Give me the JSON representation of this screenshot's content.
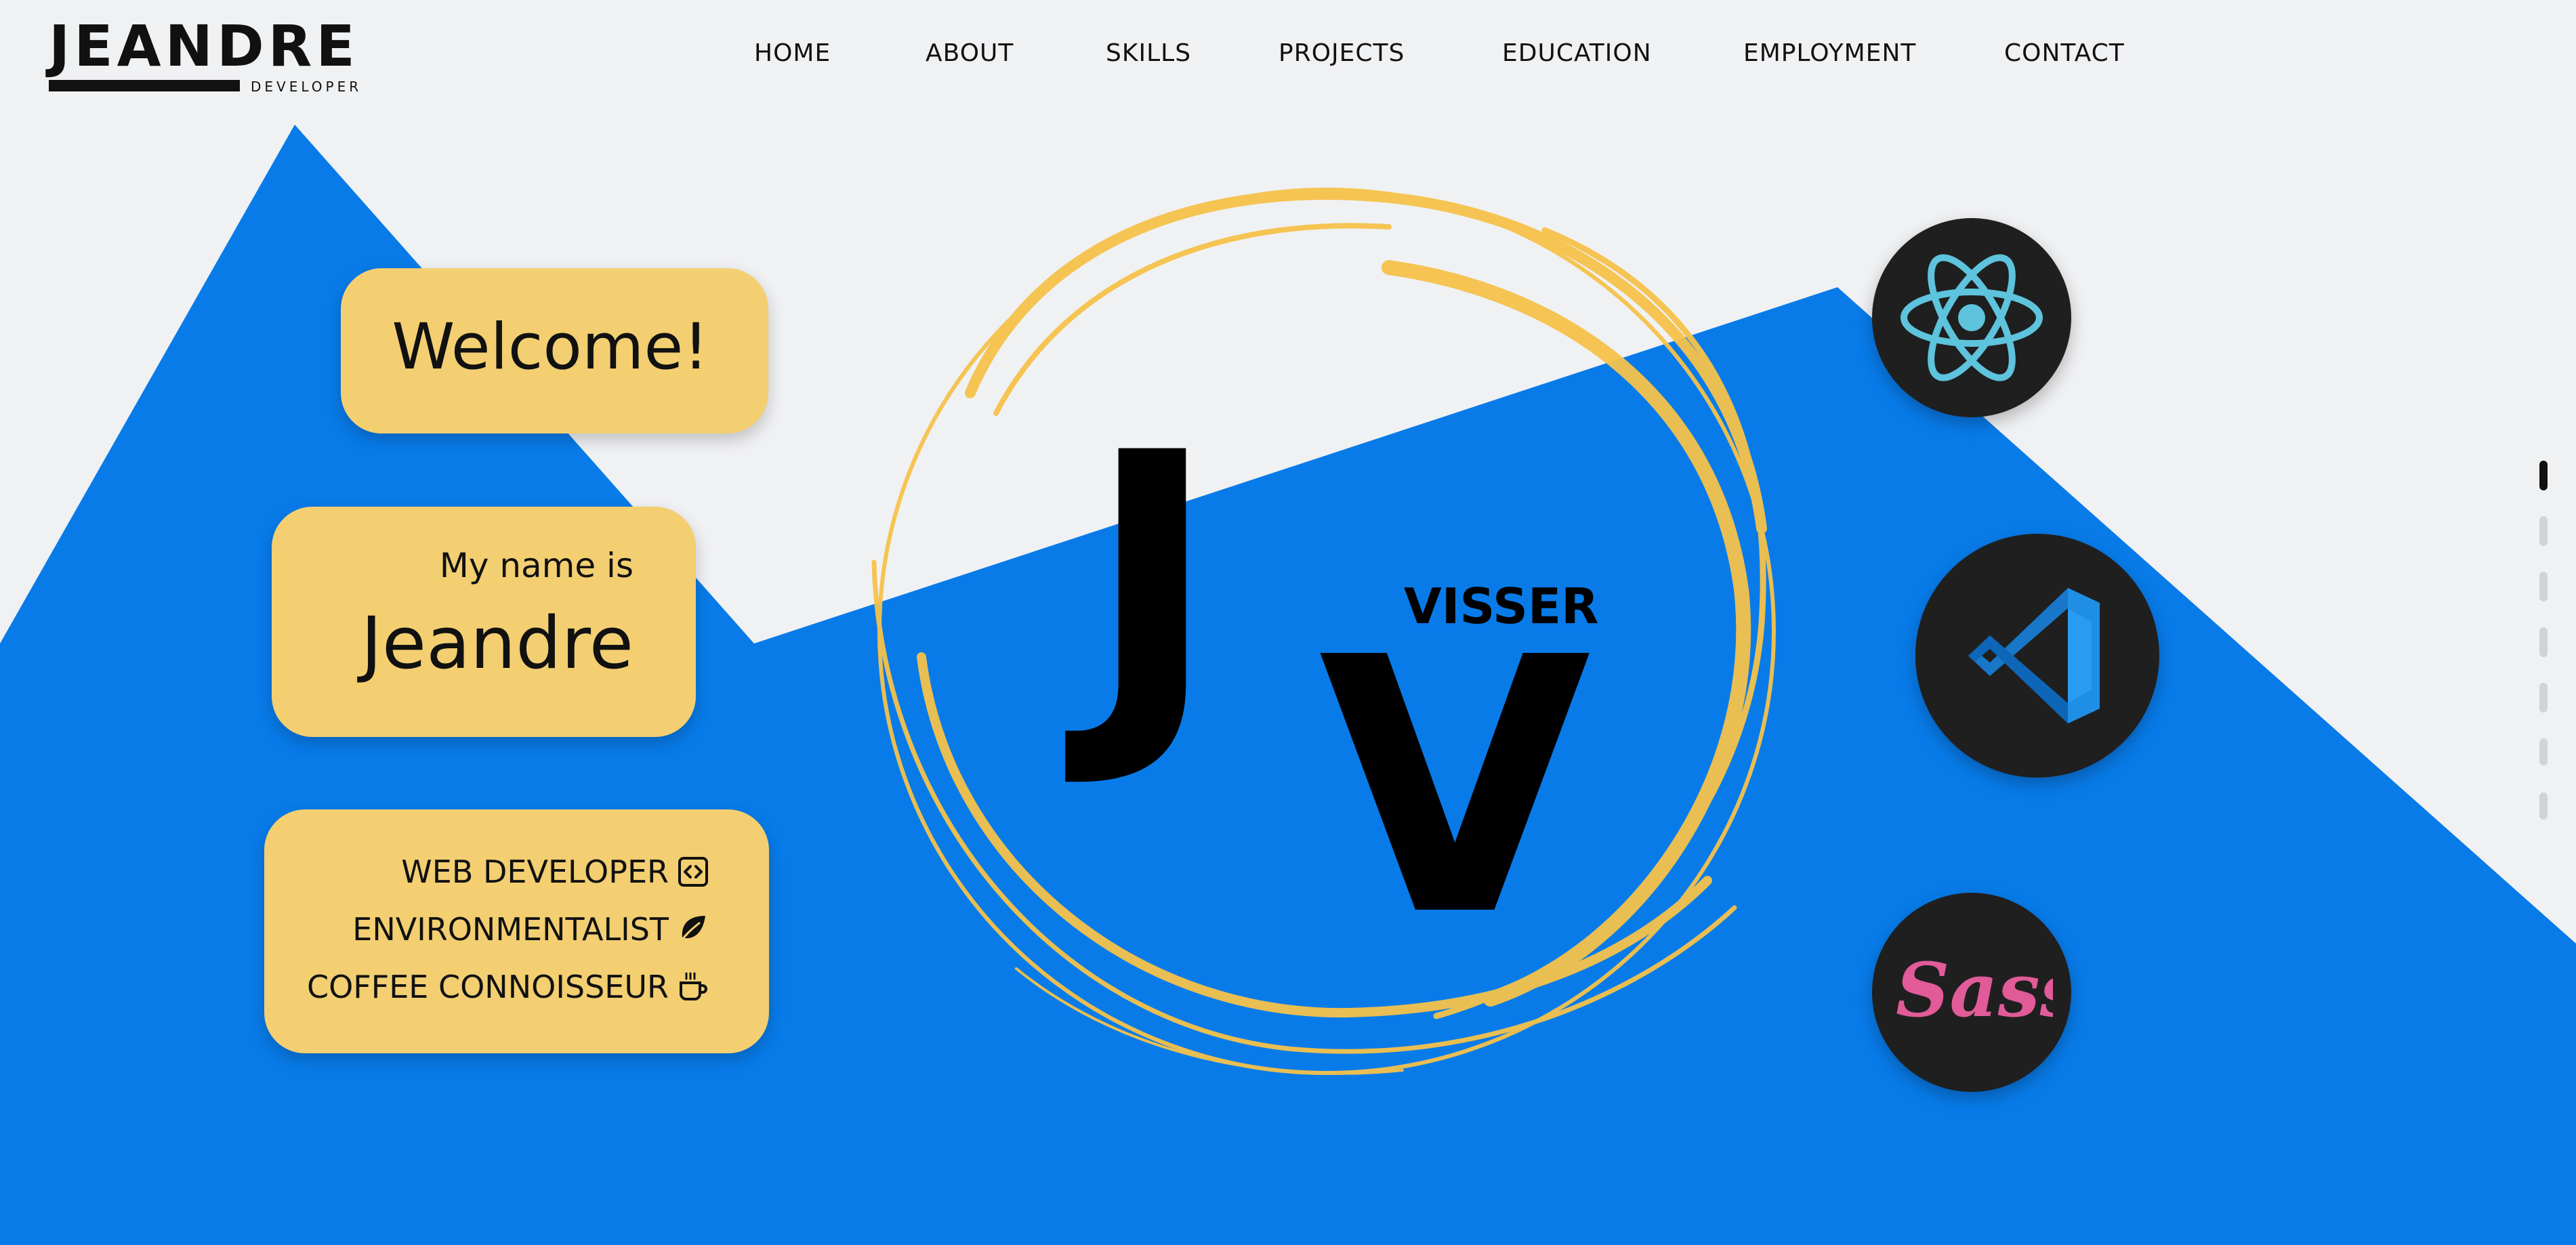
{
  "colors": {
    "background": "#f0f1f3",
    "blue": "#087be9",
    "yellow": "#f3cf72",
    "ring": "#f8c552",
    "dark": "#1f1f1f",
    "react": "#5ec3dc",
    "vscode": "#1f8fe6",
    "sass": "#e05b98"
  },
  "header": {
    "logo": {
      "name": "JEANDRE",
      "tagline": "DEVELOPER"
    },
    "nav": [
      "HOME",
      "ABOUT",
      "SKILLS",
      "PROJECTS",
      "EDUCATION",
      "EMPLOYMENT",
      "CONTACT"
    ]
  },
  "hero": {
    "welcome": "Welcome!",
    "intro": {
      "prefix": "My name is",
      "name": "Jeandre"
    },
    "roles": [
      {
        "label": "WEB DEVELOPER",
        "icon": "code-icon"
      },
      {
        "label": "ENVIRONMENTALIST",
        "icon": "leaf-icon"
      },
      {
        "label": "COFFEE CONNOISSEUR",
        "icon": "coffee-cup-icon"
      }
    ],
    "brand": {
      "letter_1": "J",
      "letter_2": "V",
      "surname": "VISSER"
    }
  },
  "tech_icons": [
    "react-icon",
    "vscode-icon",
    "sass-icon"
  ],
  "section_indicator": {
    "count": 7,
    "active_index": 0
  }
}
